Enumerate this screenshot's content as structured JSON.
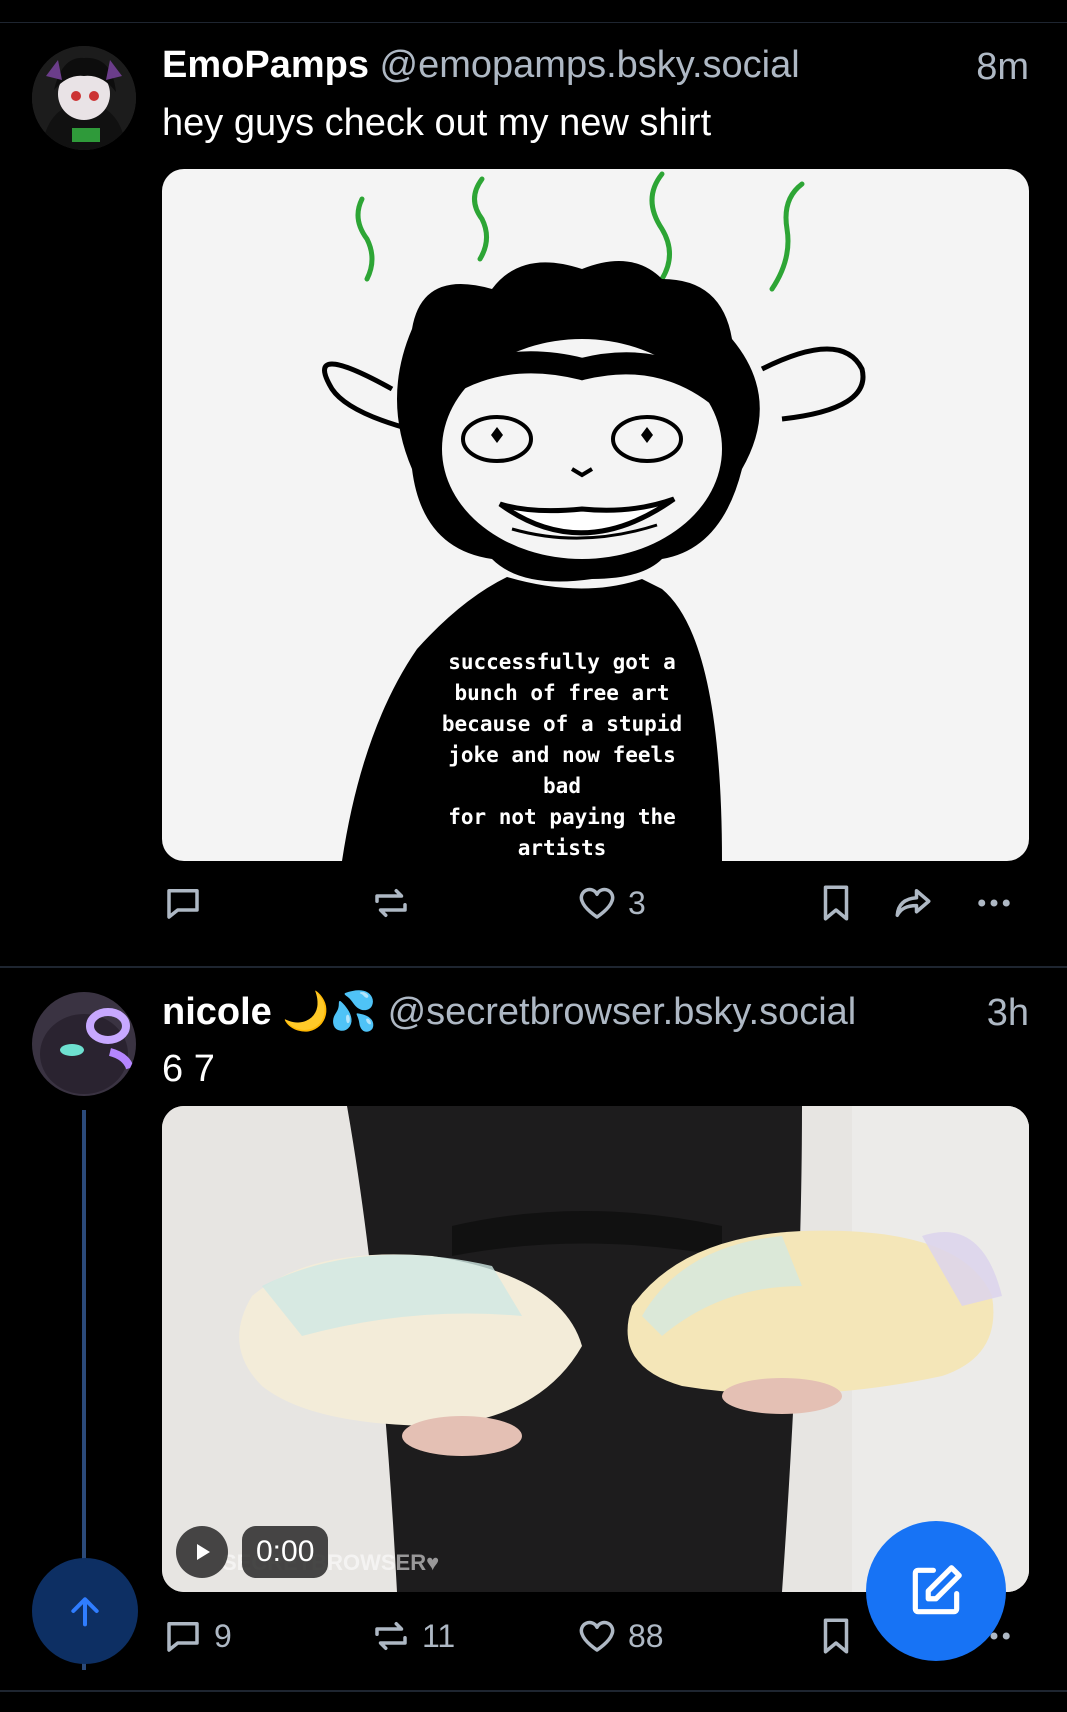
{
  "posts": [
    {
      "display_name": "EmoPamps",
      "handle": "@emopamps.bsky.social",
      "time": "8m",
      "text": "hey guys check out my new shirt",
      "image_caption": "successfully got a\nbunch of free art\nbecause of a stupid\njoke and now feels bad\nfor not paying the\nartists",
      "replies": "",
      "reposts": "",
      "likes": "3"
    },
    {
      "display_name": "nicole 🌙💦",
      "handle": "@secretbrowser.bsky.social",
      "time": "3h",
      "text": "6 7",
      "video_time": "0:00",
      "watermark": "SECRETBROWSER♥",
      "replies": "9",
      "reposts": "11",
      "likes": "88"
    }
  ],
  "colors": {
    "background": "#000000",
    "secondary_text": "#aeb8c4",
    "accent": "#1773f5",
    "separator": "#1e2530"
  },
  "icons": [
    "reply-icon",
    "repost-icon",
    "like-icon",
    "bookmark-icon",
    "share-icon",
    "more-icon",
    "play-icon",
    "compose-icon",
    "arrow-up-icon"
  ]
}
